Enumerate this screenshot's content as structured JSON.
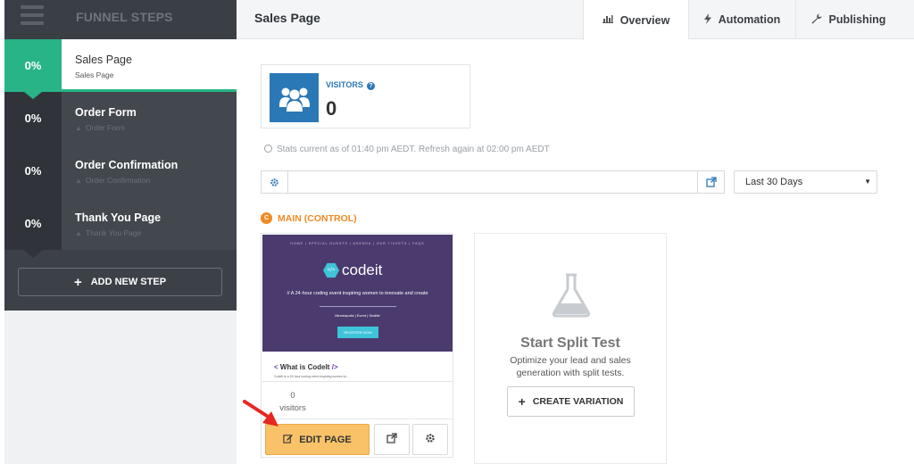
{
  "sidebar": {
    "title": "FUNNEL STEPS",
    "steps": [
      {
        "percent": "0%",
        "name": "Sales Page",
        "subtitle": "Sales Page"
      },
      {
        "percent": "0%",
        "name": "Order Form",
        "subtitle": "Order Form"
      },
      {
        "percent": "0%",
        "name": "Order Confirmation",
        "subtitle": "Order Confirmation"
      },
      {
        "percent": "0%",
        "name": "Thank You Page",
        "subtitle": "Thank You Page"
      }
    ],
    "add_step_label": "ADD NEW STEP"
  },
  "header": {
    "page_title": "Sales Page",
    "tabs": [
      {
        "label": "Overview",
        "icon": "bar-chart-icon"
      },
      {
        "label": "Automation",
        "icon": "bolt-icon"
      },
      {
        "label": "Publishing",
        "icon": "wrench-icon"
      }
    ]
  },
  "stats": {
    "visitors_label": "VISITORS",
    "visitors_value": "0",
    "note": "Stats current as of 01:40 pm AEDT. Refresh again at 02:00 pm AEDT"
  },
  "url_bar": {
    "value": "",
    "range": "Last 30 Days"
  },
  "variant": {
    "badge": "C",
    "label": "MAIN (CONTROL)",
    "thumb": {
      "nav": "HOME  |  SPECIAL GUESTS  |  AGENDA  |  OUR TICKETS  |  FAQS",
      "logo": "codeit",
      "tagline": "// A 24-hour coding event inspiring women to innovate and create",
      "place": "Minneapolis  |  Event  |  Seattle",
      "register": "REGISTER NOW",
      "what_prefix": "< ",
      "what_title": "What is CodeIt",
      "what_suffix": " />",
      "desc": "CodeIt is a 24 hour coding event inspiring women to..."
    },
    "visitors_value": "0",
    "visitors_label": "visitors",
    "edit_label": "EDIT PAGE"
  },
  "split": {
    "title": "Start Split Test",
    "description": "Optimize your lead and sales generation with split tests.",
    "button_label": "CREATE VARIATION"
  },
  "colors": {
    "accent_green": "#28b486",
    "accent_blue": "#2b78b7",
    "accent_orange": "#f08a24",
    "edit_button": "#f9c269"
  }
}
